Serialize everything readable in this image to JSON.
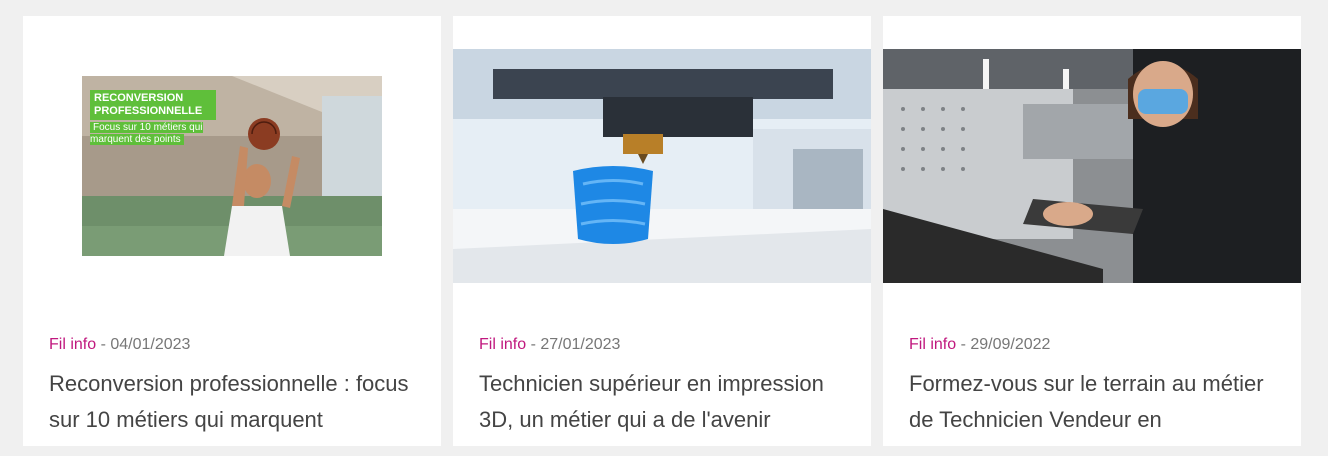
{
  "cards": [
    {
      "category": "Fil info",
      "separator": " - ",
      "date": "04/01/2023",
      "title": "Reconversion professionnelle : focus sur 10 métiers qui marquent",
      "image": {
        "overlay_title": "RECONVERSION PROFESSIONNELLE",
        "overlay_sub": "Focus sur 10 métiers qui marquent des points"
      }
    },
    {
      "category": "Fil info",
      "separator": " - ",
      "date": "27/01/2023",
      "title": "Technicien supérieur en impression 3D, un métier qui a de l'avenir"
    },
    {
      "category": "Fil info",
      "separator": " - ",
      "date": "29/09/2022",
      "title": "Formez-vous sur le terrain au métier de Technicien Vendeur en"
    }
  ]
}
